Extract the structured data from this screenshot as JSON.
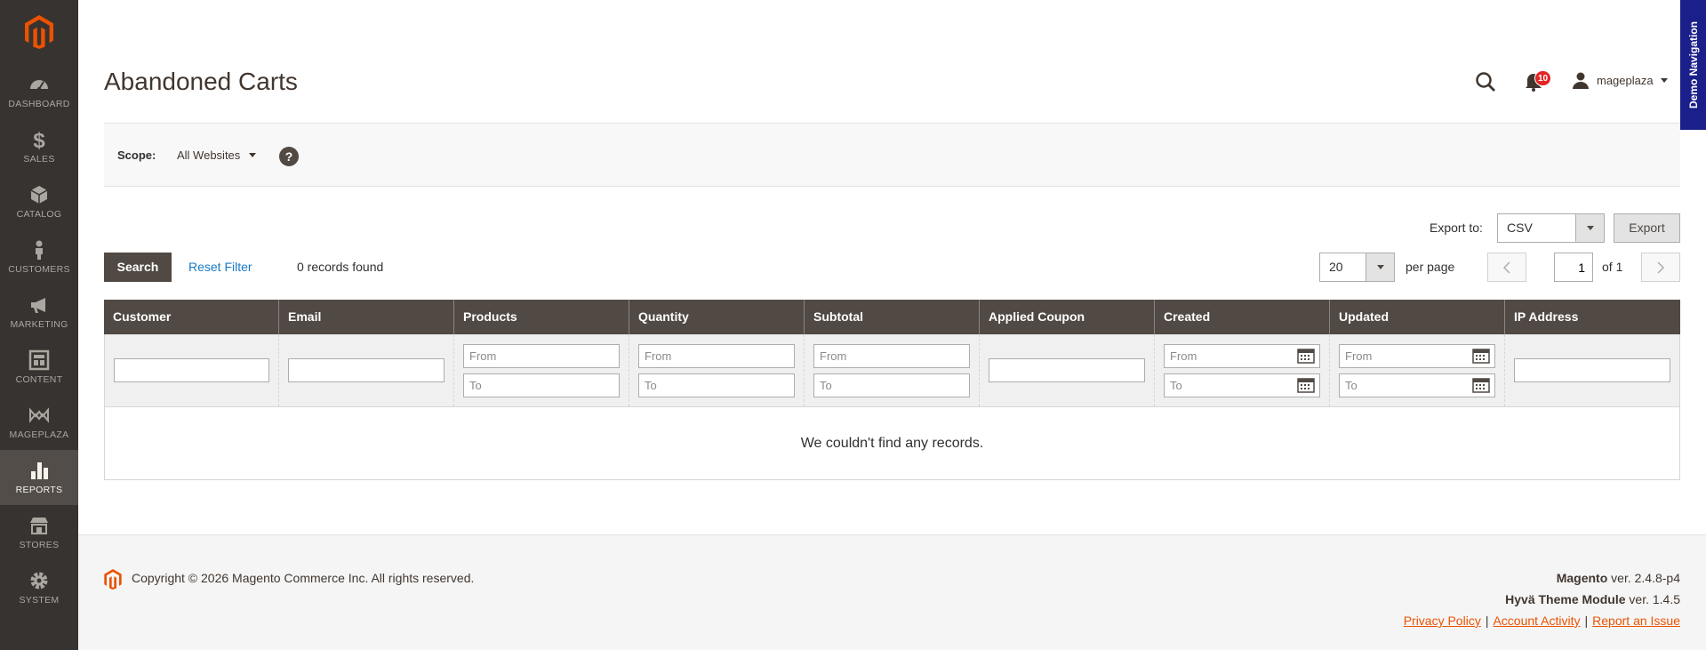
{
  "sidebar": {
    "items": [
      {
        "label": "DASHBOARD",
        "icon": "dashboard-icon"
      },
      {
        "label": "SALES",
        "icon": "dollar-icon"
      },
      {
        "label": "CATALOG",
        "icon": "box-icon"
      },
      {
        "label": "CUSTOMERS",
        "icon": "person-icon"
      },
      {
        "label": "MARKETING",
        "icon": "megaphone-icon"
      },
      {
        "label": "CONTENT",
        "icon": "layout-icon"
      },
      {
        "label": "MAGEPLAZA",
        "icon": "mageplaza-icon"
      },
      {
        "label": "REPORTS",
        "icon": "bar-chart-icon"
      },
      {
        "label": "STORES",
        "icon": "store-icon"
      },
      {
        "label": "SYSTEM",
        "icon": "gear-icon"
      }
    ],
    "active": "REPORTS"
  },
  "header": {
    "title": "Abandoned Carts",
    "notifications_count": "10",
    "user_name": "mageplaza",
    "demo_nav": "Demo Navigation"
  },
  "scope": {
    "label": "Scope:",
    "value": "All Websites",
    "help": "?"
  },
  "grid": {
    "export_label": "Export to:",
    "export_format": "CSV",
    "export_button": "Export",
    "search_button": "Search",
    "reset_filter": "Reset Filter",
    "records_found": "0 records found",
    "per_page_value": "20",
    "per_page_label": "per page",
    "page_current": "1",
    "page_of": "of 1",
    "columns": [
      "Customer",
      "Email",
      "Products",
      "Quantity",
      "Subtotal",
      "Applied Coupon",
      "Created",
      "Updated",
      "IP Address"
    ],
    "from_placeholder": "From",
    "to_placeholder": "To",
    "empty_message": "We couldn't find any records."
  },
  "footer": {
    "copyright": "Copyright © 2026 Magento Commerce Inc. All rights reserved.",
    "magento_name": "Magento",
    "magento_version": " ver. 2.4.8-p4",
    "hyva_name": "Hyvä Theme Module",
    "hyva_version": " ver. 1.4.5",
    "links": [
      "Privacy Policy",
      "Account Activity",
      "Report an Issue"
    ],
    "separator": "|"
  },
  "colors": {
    "sidebar_bg": "#373330",
    "sidebar_active": "#524d49",
    "brand_orange": "#eb5202",
    "table_header": "#514943",
    "link_blue": "#1979c3",
    "badge_red": "#e22626",
    "demo_nav_bg": "#1a1f8a"
  }
}
